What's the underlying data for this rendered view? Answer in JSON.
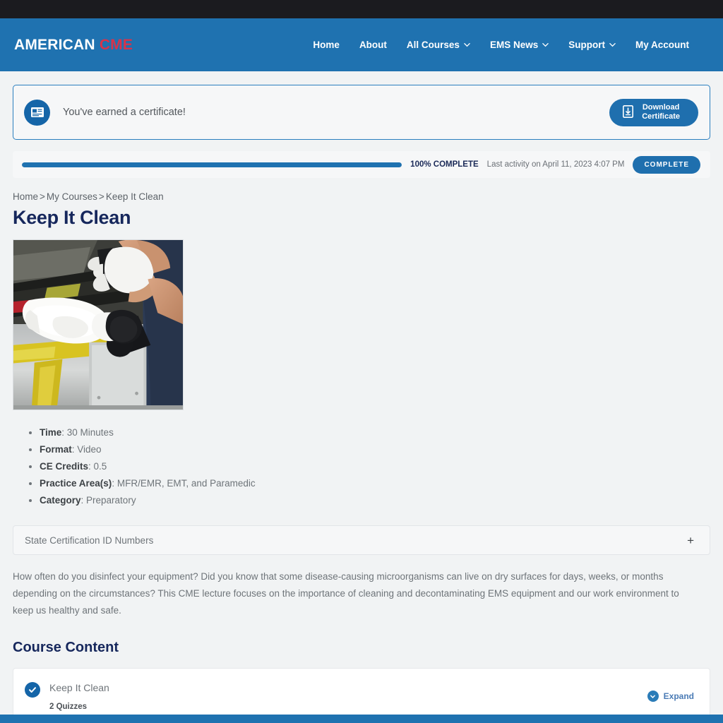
{
  "brand": {
    "word1": "AMERICAN",
    "word2": "CME"
  },
  "nav": [
    {
      "label": "Home",
      "caret": false
    },
    {
      "label": "About",
      "caret": false
    },
    {
      "label": "All Courses",
      "caret": true
    },
    {
      "label": "EMS News",
      "caret": true
    },
    {
      "label": "Support",
      "caret": true
    },
    {
      "label": "My Account",
      "caret": false
    }
  ],
  "certificate_banner": {
    "message": "You've earned a certificate!",
    "icon": "certificate-icon",
    "button_line1": "Download",
    "button_line2": "Certificate",
    "button_icon": "download-icon"
  },
  "progress": {
    "percent_label": "100% COMPLETE",
    "percent_value": 100,
    "last_activity": "Last activity on April 11, 2023 4:07 PM",
    "status_badge": "COMPLETE"
  },
  "breadcrumb": {
    "item1": "Home",
    "item2": "My Courses",
    "item3": "Keep It Clean",
    "separator": ">"
  },
  "page_title": "Keep It Clean",
  "course_image_alt": "Gloved hands cleaning an ambulance stretcher",
  "meta": [
    {
      "label": "Time",
      "value": "30 Minutes"
    },
    {
      "label": "Format",
      "value": "Video"
    },
    {
      "label": "CE Credits",
      "value": "0.5"
    },
    {
      "label": "Practice Area(s)",
      "value": "MFR/EMR, EMT, and Paramedic"
    },
    {
      "label": "Category",
      "value": "Preparatory"
    }
  ],
  "accordion": {
    "title": "State Certification ID Numbers",
    "toggle": "+"
  },
  "description": "How often do you disinfect your equipment? Did you know that some disease-causing microorganisms can live on dry surfaces for days, weeks, or months depending on the circumstances? This CME lecture focuses on the importance of cleaning and decontaminating EMS equipment and our work environment to keep us healthy and safe.",
  "course_content": {
    "heading": "Course Content",
    "lesson_title": "Keep It Clean",
    "lesson_sub": "2 Quizzes",
    "expand_label": "Expand"
  },
  "colors": {
    "header_blue": "#1f72b0",
    "accent_red": "#d8334a",
    "navy": "#16275c",
    "badge_blue": "#1f6fae",
    "topbar": "#1b1b1f"
  }
}
